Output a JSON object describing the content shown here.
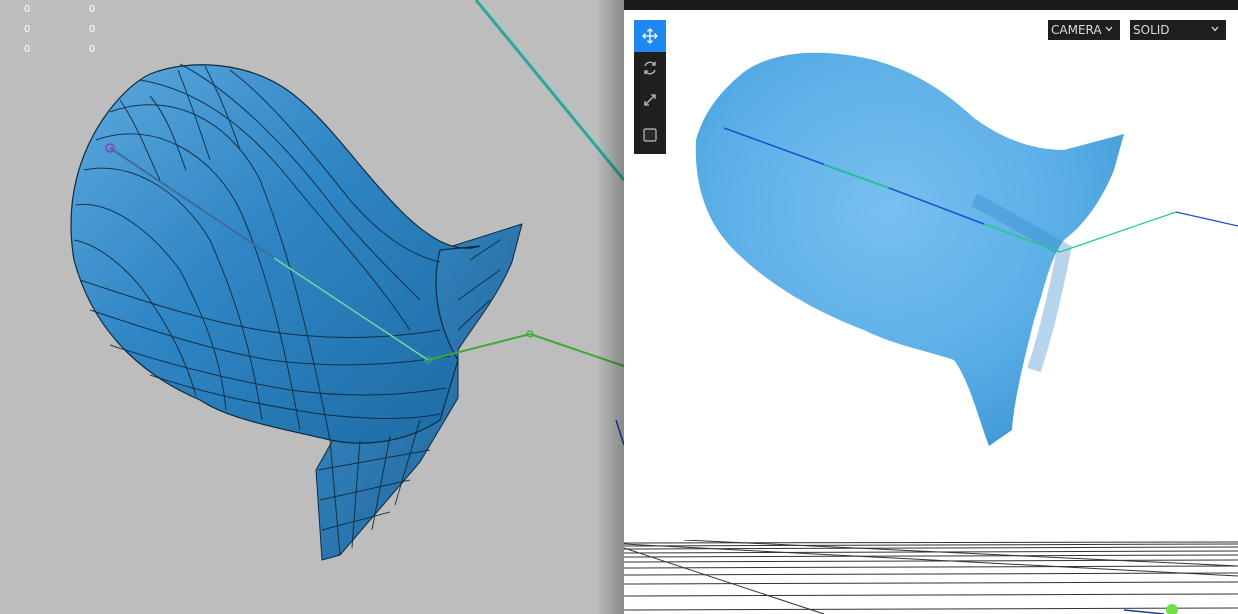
{
  "left_viewport": {
    "coordinates": [
      [
        "0",
        "0"
      ],
      [
        "0",
        "0"
      ],
      [
        "0",
        "0"
      ]
    ]
  },
  "preview": {
    "toolbar": {
      "tools": [
        {
          "icon": "move-icon",
          "active": true
        },
        {
          "icon": "rotate-icon",
          "active": false
        },
        {
          "icon": "scale-icon",
          "active": false
        },
        {
          "icon": "box-select-icon",
          "active": false
        }
      ]
    },
    "camera_dropdown": {
      "value": "CAMERA"
    },
    "shading_dropdown": {
      "value": "SOLID"
    }
  },
  "colors": {
    "viewport_bg": "#bdbdbd",
    "mesh_blue": "#2f86c4",
    "mesh_highlight": "#5aa6dc",
    "render_blue": "#62b2ea",
    "bone_green": "#4fb84b",
    "bone_teal": "#38b5a8",
    "accent_blue": "#1e88f0"
  }
}
